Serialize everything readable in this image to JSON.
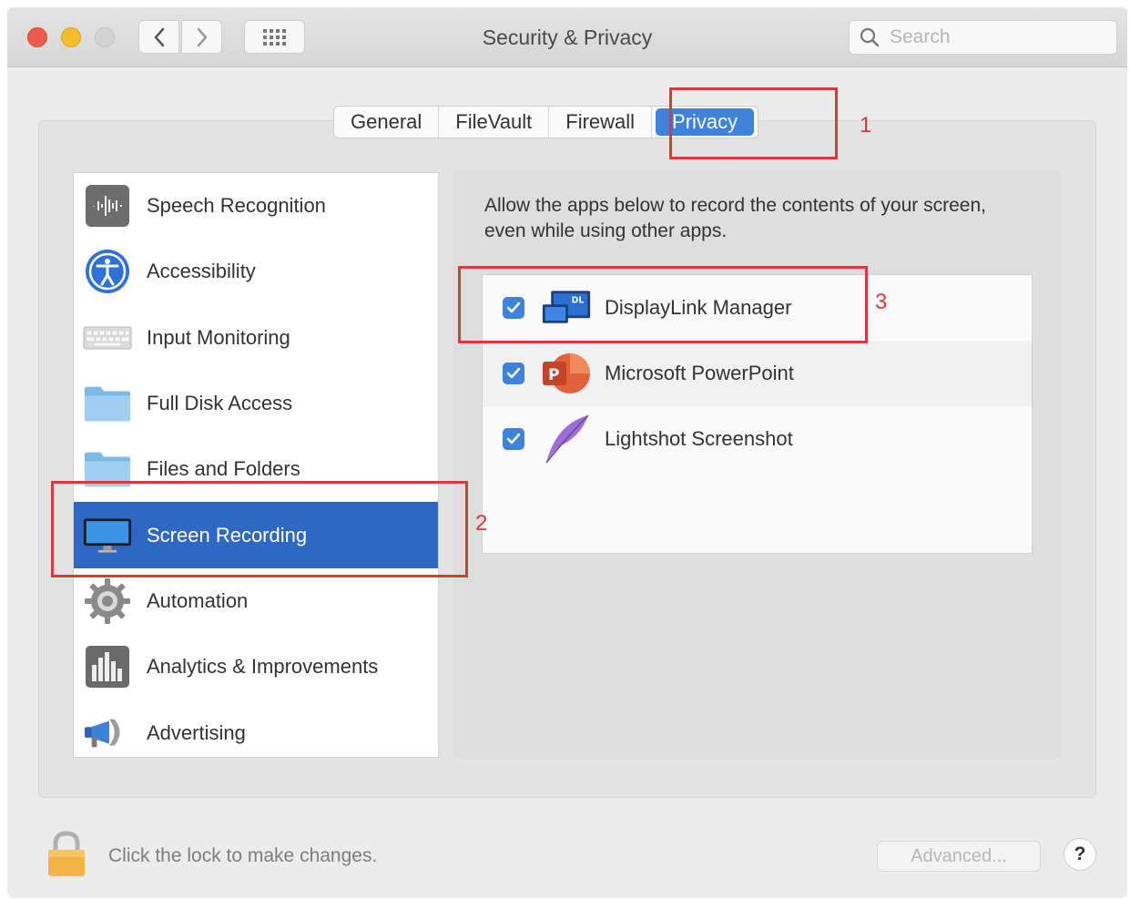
{
  "window": {
    "title": "Security & Privacy",
    "search_placeholder": "Search"
  },
  "tabs": [
    {
      "label": "General",
      "active": false
    },
    {
      "label": "FileVault",
      "active": false
    },
    {
      "label": "Firewall",
      "active": false
    },
    {
      "label": "Privacy",
      "active": true
    }
  ],
  "sidebar": {
    "items": [
      {
        "label": "Speech Recognition",
        "icon": "speech-recognition-icon"
      },
      {
        "label": "Accessibility",
        "icon": "accessibility-icon"
      },
      {
        "label": "Input Monitoring",
        "icon": "keyboard-icon"
      },
      {
        "label": "Full Disk Access",
        "icon": "folder-icon"
      },
      {
        "label": "Files and Folders",
        "icon": "folder-icon"
      },
      {
        "label": "Screen Recording",
        "icon": "display-icon",
        "selected": true
      },
      {
        "label": "Automation",
        "icon": "gear-icon"
      },
      {
        "label": "Analytics & Improvements",
        "icon": "analytics-icon"
      },
      {
        "label": "Advertising",
        "icon": "megaphone-icon"
      }
    ]
  },
  "main": {
    "description": "Allow the apps below to record the contents of your screen, even while using other apps.",
    "apps": [
      {
        "name": "DisplayLink Manager",
        "checked": true,
        "icon": "displaylink-icon"
      },
      {
        "name": "Microsoft PowerPoint",
        "checked": true,
        "icon": "powerpoint-icon"
      },
      {
        "name": "Lightshot Screenshot",
        "checked": true,
        "icon": "feather-icon"
      }
    ]
  },
  "footer": {
    "lock_text": "Click the lock to make changes.",
    "advanced_label": "Advanced...",
    "help_label": "?"
  },
  "annotations": {
    "step1": "1",
    "step2": "2",
    "step3": "3"
  },
  "colors": {
    "accent": "#3e82dc",
    "selection": "#2f67c4",
    "annotation": "#d83a3a"
  }
}
